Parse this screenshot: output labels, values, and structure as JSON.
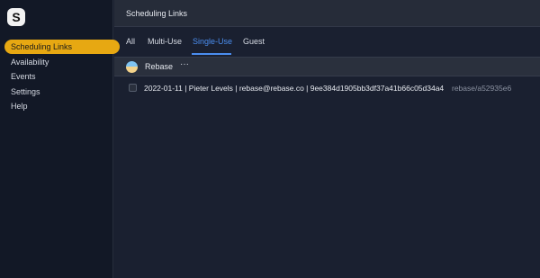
{
  "app": {
    "logo_letter": "S"
  },
  "sidebar": {
    "items": [
      {
        "label": "Scheduling Links",
        "active": true
      },
      {
        "label": "Availability"
      },
      {
        "label": "Events"
      },
      {
        "label": "Settings"
      },
      {
        "label": "Help"
      }
    ]
  },
  "header": {
    "title": "Scheduling Links"
  },
  "tabs": [
    {
      "label": "All"
    },
    {
      "label": "Multi-Use"
    },
    {
      "label": "Single-Use",
      "active": true
    },
    {
      "label": "Guest"
    }
  ],
  "group": {
    "name": "Rebase",
    "more_icon": "ellipsis-icon",
    "more_label": "···"
  },
  "links": [
    {
      "text": "2022-01-11 | Pieter Levels | rebase@rebase.co | 9ee384d1905bb3df37a41b66c05d34a4",
      "slug": "rebase/a52935e6"
    }
  ],
  "colors": {
    "accent": "#e7a812",
    "tab_active": "#4b8ef0"
  }
}
